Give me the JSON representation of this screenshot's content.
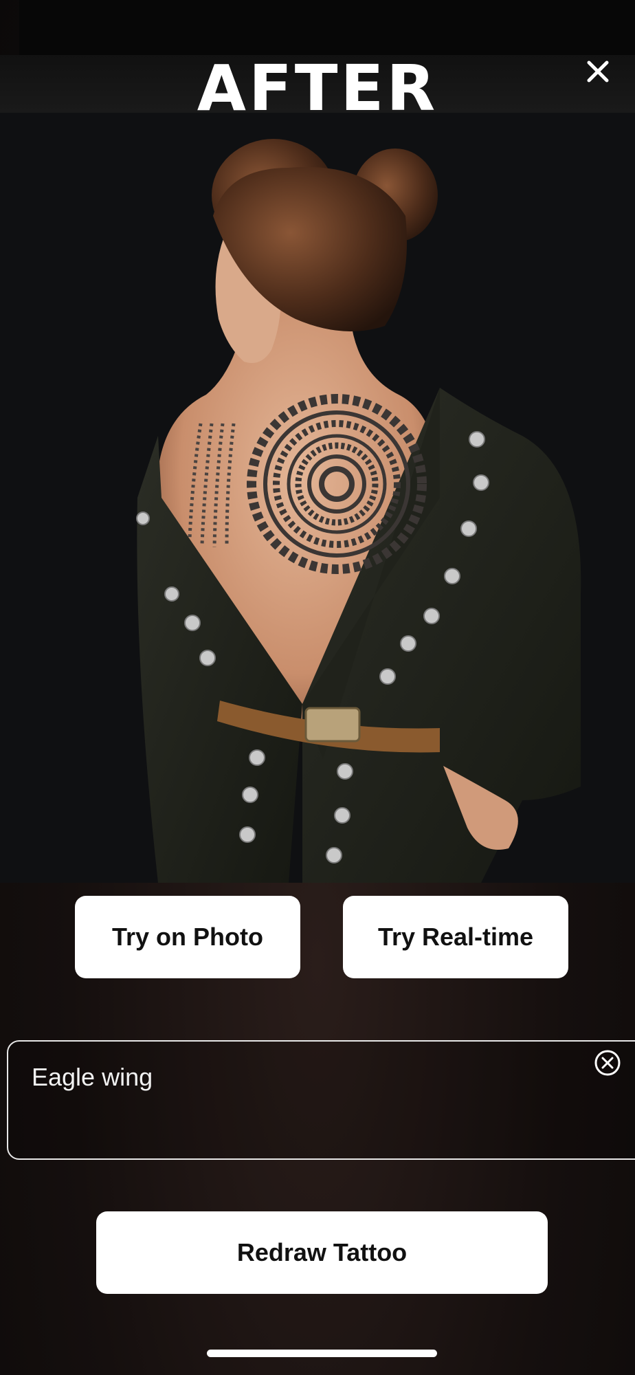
{
  "header": {
    "title": "AFTER",
    "close_icon": "close-icon"
  },
  "photo": {
    "alt": "woman with mandala back tattoo"
  },
  "actions": {
    "try_on_photo_label": "Try on Photo",
    "try_realtime_label": "Try Real-time"
  },
  "prompt": {
    "value": "Eagle wing",
    "clear_icon": "clear-circle-icon"
  },
  "redraw": {
    "label": "Redraw Tattoo"
  },
  "colors": {
    "button_bg": "#ffffff",
    "button_text": "#111111",
    "background": "#150f0e"
  }
}
